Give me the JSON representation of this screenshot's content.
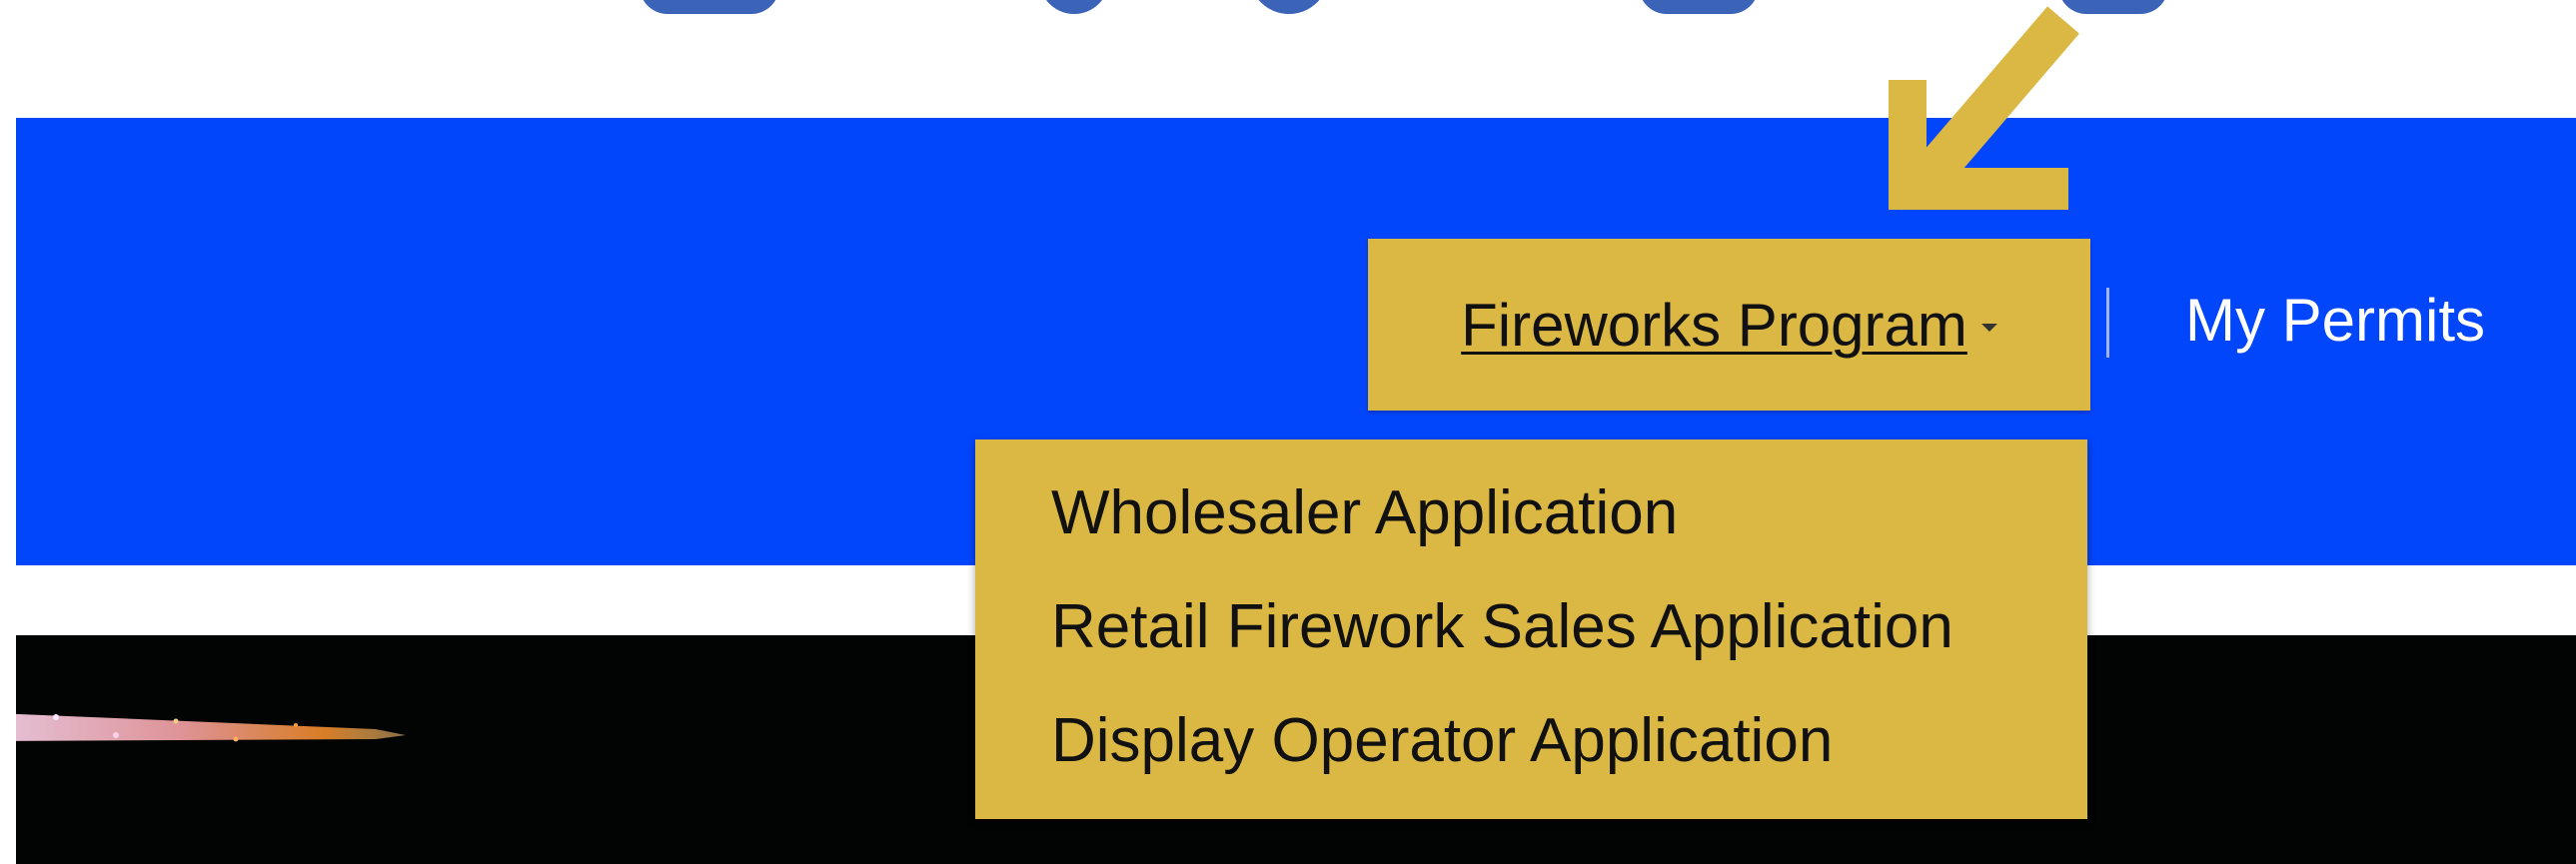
{
  "nav": {
    "program_label": "Fireworks Program ",
    "program_caret_icon": "caret-down-icon",
    "permits_label": "My Permits"
  },
  "dropdown": {
    "items": [
      "Wholesaler Application",
      "Retail Firework Sales Application",
      "Display Operator Application"
    ]
  },
  "annotation": {
    "arrow_icon": "arrow-down-left-icon",
    "arrow_color": "#dbb843"
  },
  "colors": {
    "navbar": "#0246fc",
    "highlight": "#dbb843",
    "hero": "#020403"
  }
}
